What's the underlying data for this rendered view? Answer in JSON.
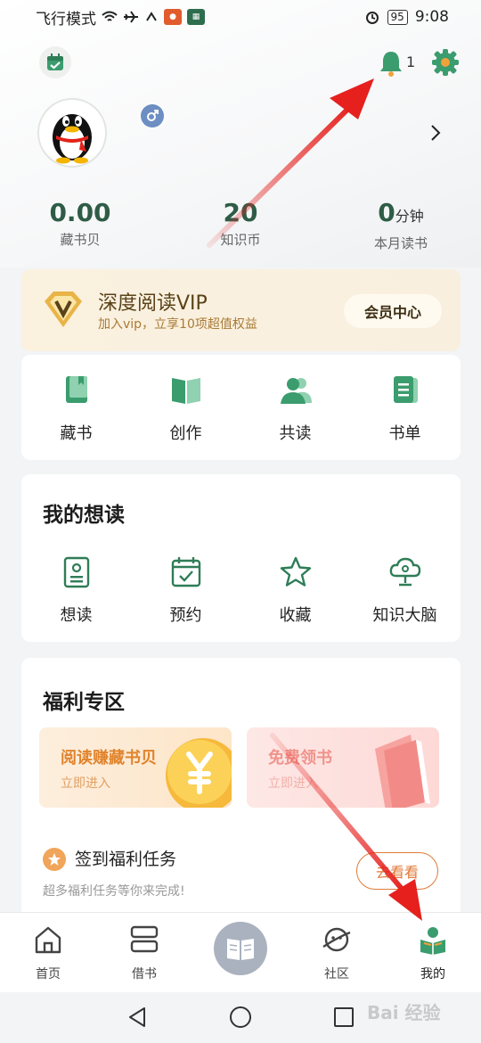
{
  "status_bar": {
    "left_text": "飞行模式",
    "time": "9:08",
    "battery": "95"
  },
  "header": {
    "notification_count": "1"
  },
  "stats": [
    {
      "value": "0.00",
      "unit": "",
      "label": "藏书贝"
    },
    {
      "value": "20",
      "unit": "",
      "label": "知识币"
    },
    {
      "value": "0",
      "unit": "分钟",
      "label": "本月读书"
    }
  ],
  "vip": {
    "title": "深度阅读VIP",
    "subtitle": "加入vip，立享10项超值权益",
    "button": "会员中心"
  },
  "shortcuts": [
    {
      "label": "藏书",
      "icon": "book-icon"
    },
    {
      "label": "创作",
      "icon": "open-book-icon"
    },
    {
      "label": "共读",
      "icon": "users-icon"
    },
    {
      "label": "书单",
      "icon": "list-icon"
    }
  ],
  "wishlist": {
    "title": "我的想读",
    "items": [
      {
        "label": "想读",
        "icon": "profile-card-icon"
      },
      {
        "label": "预约",
        "icon": "calendar-check-icon"
      },
      {
        "label": "收藏",
        "icon": "star-icon"
      },
      {
        "label": "知识大脑",
        "icon": "brain-cloud-icon"
      }
    ]
  },
  "welfare": {
    "title": "福利专区",
    "banner_left": {
      "title": "阅读赚藏书贝",
      "sub": "立即进入"
    },
    "banner_right": {
      "title": "免费领书",
      "sub": "立即进入"
    },
    "task_title": "签到福利任务",
    "task_sub": "超多福利任务等你来完成!",
    "task_button": "去看看"
  },
  "tabs": [
    {
      "label": "首页"
    },
    {
      "label": "借书"
    },
    {
      "label": "社区"
    },
    {
      "label": "我的"
    }
  ],
  "watermark": "Bai 经验",
  "colors": {
    "brand_green": "#2f5c46",
    "icon_green": "#3b9c6e",
    "vip_gold": "#e8b447",
    "accent_orange": "#e07a3a",
    "arrow_red": "#e5201d"
  }
}
